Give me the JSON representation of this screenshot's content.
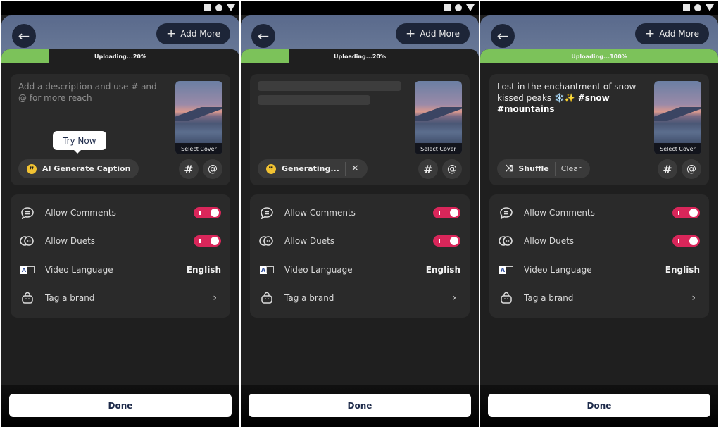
{
  "screens": [
    {
      "header": {
        "add_more_label": "Add More"
      },
      "upload": {
        "label": "Uploading...20%",
        "progress_percent": 20
      },
      "description": {
        "placeholder": "Add a description and use # and @ for more reach"
      },
      "tooltip": "Try Now",
      "caption_button": {
        "label": "AI Generate Caption"
      },
      "cover_label": "Select Cover",
      "settings": {
        "allow_comments": {
          "label": "Allow Comments",
          "on": true
        },
        "allow_duets": {
          "label": "Allow Duets",
          "on": true
        },
        "video_language": {
          "label": "Video Language",
          "value": "English"
        },
        "tag_brand": {
          "label": "Tag a brand"
        }
      },
      "done_label": "Done"
    },
    {
      "header": {
        "add_more_label": "Add More"
      },
      "upload": {
        "label": "Uploading...20%",
        "progress_percent": 20
      },
      "caption_button": {
        "label": "Generating..."
      },
      "cover_label": "Select Cover",
      "settings": {
        "allow_comments": {
          "label": "Allow Comments",
          "on": true
        },
        "allow_duets": {
          "label": "Allow Duets",
          "on": true
        },
        "video_language": {
          "label": "Video Language",
          "value": "English"
        },
        "tag_brand": {
          "label": "Tag a brand"
        }
      },
      "done_label": "Done"
    },
    {
      "header": {
        "add_more_label": "Add More"
      },
      "upload": {
        "label": "Uploading...100%",
        "progress_percent": 100
      },
      "description": {
        "text": "Lost in the enchantment of snow-kissed peaks ❄️✨",
        "hashtags": "#snow #mountains"
      },
      "caption_button": {
        "label": "Shuffle",
        "clear_label": "Clear"
      },
      "cover_label": "Select Cover",
      "settings": {
        "allow_comments": {
          "label": "Allow Comments",
          "on": true
        },
        "allow_duets": {
          "label": "Allow Duets",
          "on": true
        },
        "video_language": {
          "label": "Video Language",
          "value": "English"
        },
        "tag_brand": {
          "label": "Tag a brand"
        }
      },
      "done_label": "Done"
    }
  ],
  "icons": {
    "hash": "#",
    "at": "@",
    "back": "←",
    "plus": "+",
    "close": "✕",
    "chevron": "›",
    "shuffle": "⤨"
  },
  "colors": {
    "progress": "#7cc25a",
    "toggle_on": "#d9265a",
    "ai_icon": "#f1c232"
  }
}
